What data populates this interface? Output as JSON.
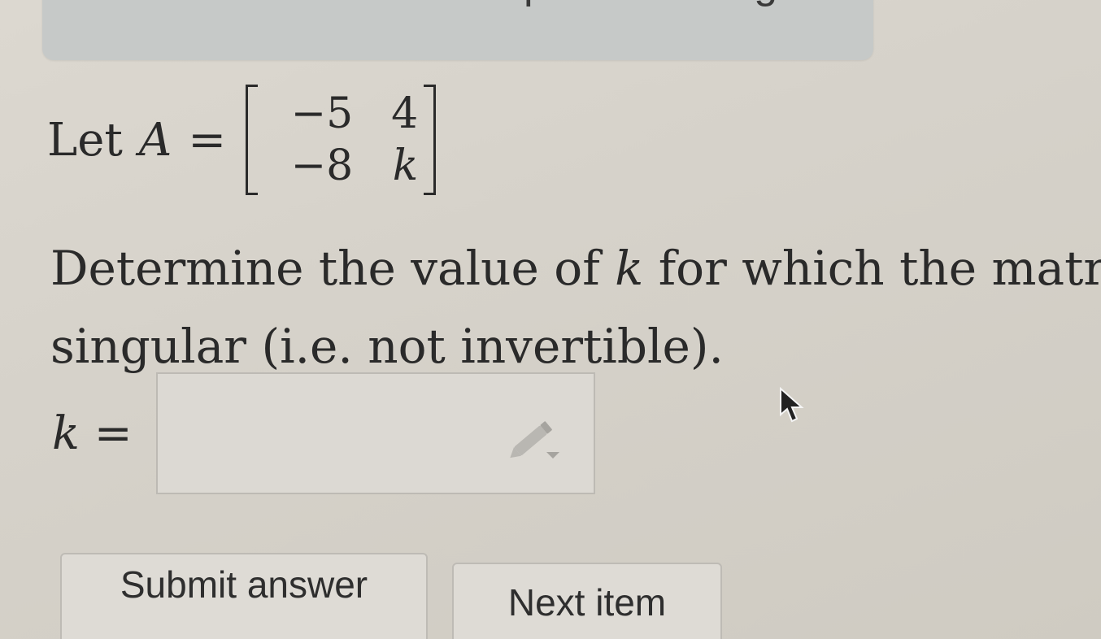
{
  "banner": {
    "text": "…pts remaining."
  },
  "problem": {
    "let_word": "Let",
    "matrix_name": "A",
    "equals": "=",
    "matrix": [
      [
        "−5",
        "4"
      ],
      [
        "−8",
        "k"
      ]
    ],
    "question_line1_pre": "Determine the value of ",
    "question_var": "k",
    "question_line1_post": " for which the matri",
    "question_line2": "singular (i.e. not invertible)."
  },
  "answer": {
    "var": "k",
    "equals": " =",
    "value": "",
    "editor_icon": "pencil-icon"
  },
  "buttons": {
    "submit_label": "Submit answer",
    "next_label": "Next item"
  },
  "colors": {
    "background": "#d6d2ca",
    "banner": "#c6c9c8",
    "text": "#2a2a2a"
  }
}
